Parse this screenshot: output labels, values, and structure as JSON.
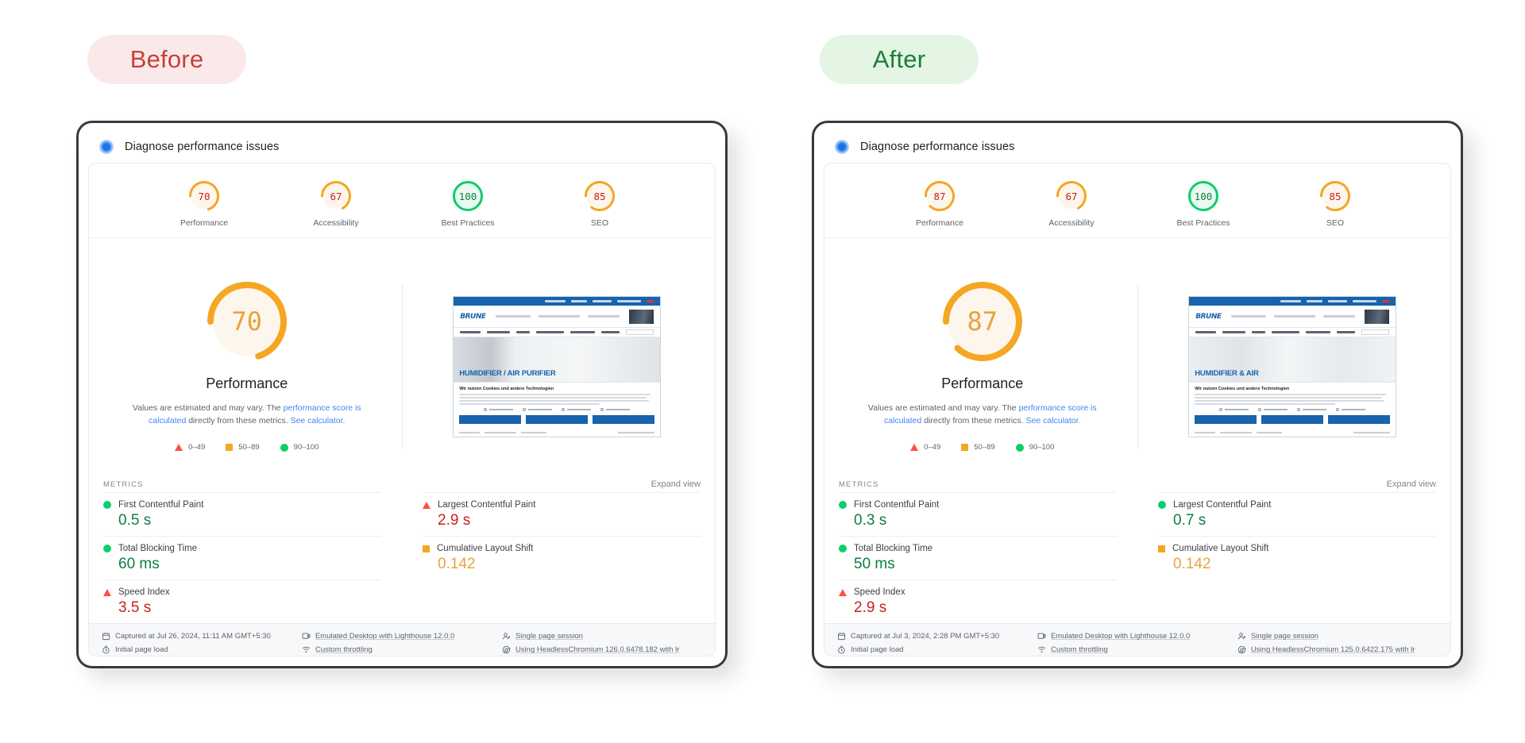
{
  "badges": {
    "before": "Before",
    "after": "After"
  },
  "panels": [
    {
      "key": "before",
      "header_title": "Diagnose performance issues",
      "scores": [
        {
          "label": "Performance",
          "value": "70",
          "pct": 70,
          "status": "orange"
        },
        {
          "label": "Accessibility",
          "value": "67",
          "pct": 67,
          "status": "orange"
        },
        {
          "label": "Best Practices",
          "value": "100",
          "pct": 100,
          "status": "green"
        },
        {
          "label": "SEO",
          "value": "85",
          "pct": 85,
          "status": "orange"
        }
      ],
      "performance": {
        "value": "70",
        "pct": 70,
        "title": "Performance",
        "desc_part1": "Values are estimated and may vary. The ",
        "desc_link1": "performance score is calculated",
        "desc_part2": " directly from these metrics. ",
        "desc_link2": "See calculator."
      },
      "legend": [
        {
          "shape": "triangle",
          "range": "0–49"
        },
        {
          "shape": "square",
          "range": "50–89"
        },
        {
          "shape": "circle",
          "range": "90–100"
        }
      ],
      "metrics_label": "METRICS",
      "expand_view": "Expand view",
      "metrics_left": [
        {
          "name": "First Contentful Paint",
          "value": "0.5 s",
          "status": "green"
        },
        {
          "name": "Total Blocking Time",
          "value": "60 ms",
          "status": "green"
        },
        {
          "name": "Speed Index",
          "value": "3.5 s",
          "status": "red"
        }
      ],
      "metrics_right": [
        {
          "name": "Largest Contentful Paint",
          "value": "2.9 s",
          "status": "red"
        },
        {
          "name": "Cumulative Layout Shift",
          "value": "0.142",
          "status": "orange"
        }
      ],
      "thumbnail": {
        "logo": "BRUNE",
        "hero_label": "HUMIDIFIER / AIR PURIFIER",
        "cookie_title": "Wir nutzen Cookies und andere Technologien"
      },
      "meta": [
        {
          "icon": "calendar-icon",
          "text": "Captured at Jul 26, 2024, 11:11 AM GMT+5:30",
          "underline": false
        },
        {
          "icon": "desktop-icon",
          "text": "Emulated Desktop with Lighthouse 12.0.0",
          "underline": true
        },
        {
          "icon": "person-icon",
          "text": "Single page session",
          "underline": true
        },
        {
          "icon": "clock-icon",
          "text": "Initial page load",
          "underline": false
        },
        {
          "icon": "wifi-icon",
          "text": "Custom throttling",
          "underline": true
        },
        {
          "icon": "chrome-icon",
          "text": "Using HeadlessChromium 126.0.6478.182 with lr",
          "underline": true
        }
      ]
    },
    {
      "key": "after",
      "header_title": "Diagnose performance issues",
      "scores": [
        {
          "label": "Performance",
          "value": "87",
          "pct": 87,
          "status": "orange"
        },
        {
          "label": "Accessibility",
          "value": "67",
          "pct": 67,
          "status": "orange"
        },
        {
          "label": "Best Practices",
          "value": "100",
          "pct": 100,
          "status": "green"
        },
        {
          "label": "SEO",
          "value": "85",
          "pct": 85,
          "status": "orange"
        }
      ],
      "performance": {
        "value": "87",
        "pct": 87,
        "title": "Performance",
        "desc_part1": "Values are estimated and may vary. The ",
        "desc_link1": "performance score is calculated",
        "desc_part2": " directly from these metrics. ",
        "desc_link2": "See calculator."
      },
      "legend": [
        {
          "shape": "triangle",
          "range": "0–49"
        },
        {
          "shape": "square",
          "range": "50–89"
        },
        {
          "shape": "circle",
          "range": "90–100"
        }
      ],
      "metrics_label": "METRICS",
      "expand_view": "Expand view",
      "metrics_left": [
        {
          "name": "First Contentful Paint",
          "value": "0.3 s",
          "status": "green"
        },
        {
          "name": "Total Blocking Time",
          "value": "50 ms",
          "status": "green"
        },
        {
          "name": "Speed Index",
          "value": "2.9 s",
          "status": "red"
        }
      ],
      "metrics_right": [
        {
          "name": "Largest Contentful Paint",
          "value": "0.7 s",
          "status": "green"
        },
        {
          "name": "Cumulative Layout Shift",
          "value": "0.142",
          "status": "orange"
        }
      ],
      "thumbnail": {
        "logo": "BRUNE",
        "hero_label": "HUMIDIFIER & AIR",
        "cookie_title": "Wir nutzen Cookies und andere Technologien"
      },
      "meta": [
        {
          "icon": "calendar-icon",
          "text": "Captured at Jul 3, 2024, 2:28 PM GMT+5:30",
          "underline": false
        },
        {
          "icon": "desktop-icon",
          "text": "Emulated Desktop with Lighthouse 12.0.0",
          "underline": true
        },
        {
          "icon": "person-icon",
          "text": "Single page session",
          "underline": true
        },
        {
          "icon": "clock-icon",
          "text": "Initial page load",
          "underline": false
        },
        {
          "icon": "wifi-icon",
          "text": "Custom throttling",
          "underline": true
        },
        {
          "icon": "chrome-icon",
          "text": "Using HeadlessChromium 125.0.6422.175 with lr",
          "underline": true
        }
      ]
    }
  ],
  "colors": {
    "orange": "#f5a623",
    "green": "#0cce6b",
    "red": "#ff4e42",
    "orange_text": "#e8a33d",
    "green_text": "#0b8043",
    "red_text": "#c5221f",
    "link": "#4285f4",
    "before_badge_bg": "#fbe9e9",
    "before_badge_fg": "#c5403c",
    "after_badge_bg": "#e4f5e4",
    "after_badge_fg": "#188038"
  }
}
